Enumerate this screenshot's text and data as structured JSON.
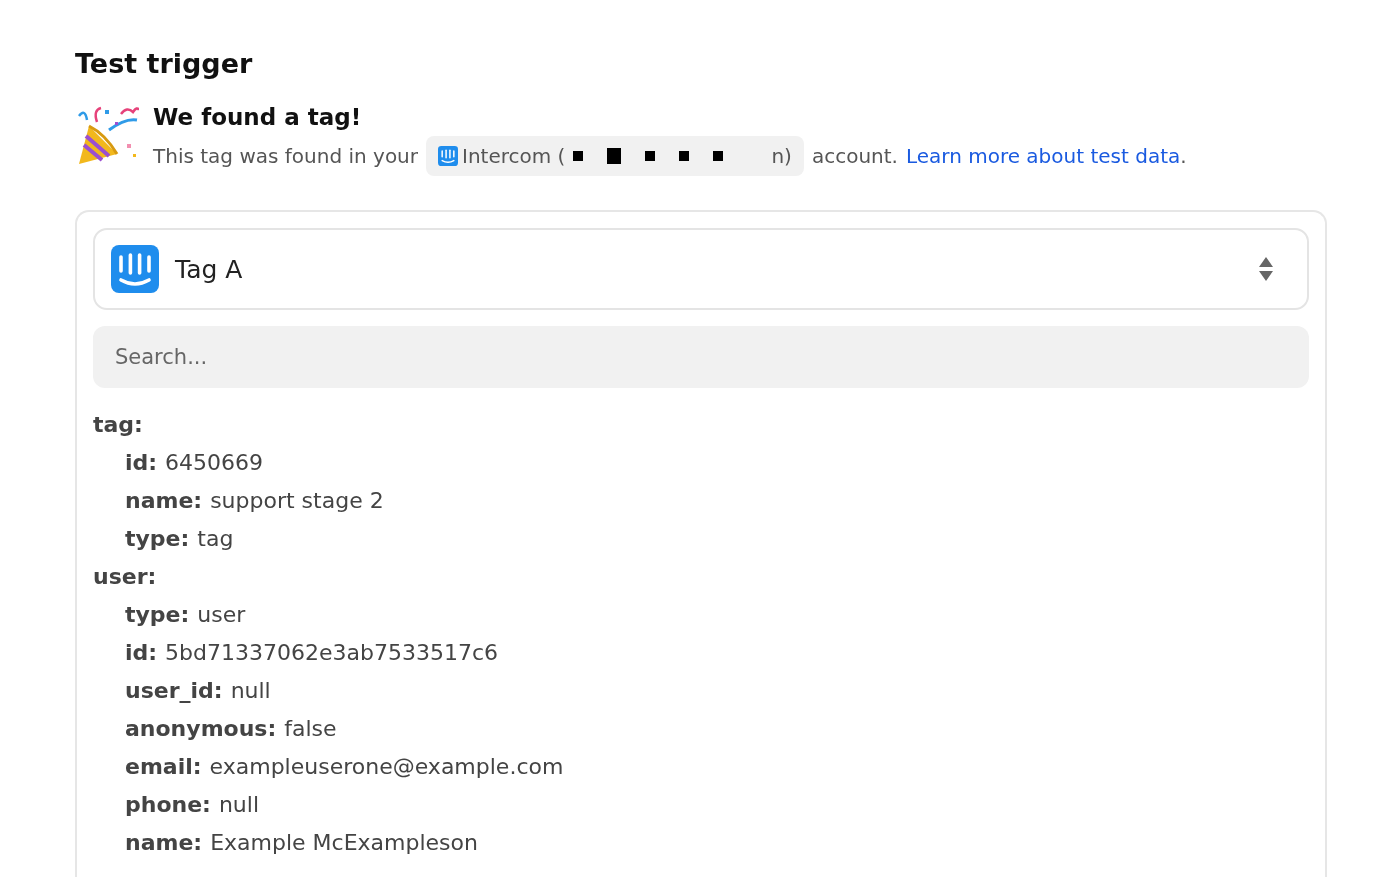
{
  "title": "Test trigger",
  "notice": {
    "heading": "We found a tag!",
    "text_before": "This tag was found in your",
    "account_prefix": "Intercom (",
    "account_suffix": "n)",
    "text_after": "account.",
    "link": "Learn more about test data",
    "link_end": "."
  },
  "selector": {
    "value": "Tag A"
  },
  "search": {
    "placeholder": "Search..."
  },
  "tree": [
    {
      "key": "tag:",
      "children": [
        {
          "key": "id:",
          "value": "6450669"
        },
        {
          "key": "name:",
          "value": "support stage 2"
        },
        {
          "key": "type:",
          "value": "tag"
        }
      ]
    },
    {
      "key": "user:",
      "children": [
        {
          "key": "type:",
          "value": "user"
        },
        {
          "key": "id:",
          "value": "5bd71337062e3ab7533517c6"
        },
        {
          "key": "user_id:",
          "value": "null"
        },
        {
          "key": "anonymous:",
          "value": "false"
        },
        {
          "key": "email:",
          "value": "exampleuserone@example.com"
        },
        {
          "key": "phone:",
          "value": "null"
        },
        {
          "key": "name:",
          "value": "Example McExampleson"
        }
      ]
    }
  ]
}
